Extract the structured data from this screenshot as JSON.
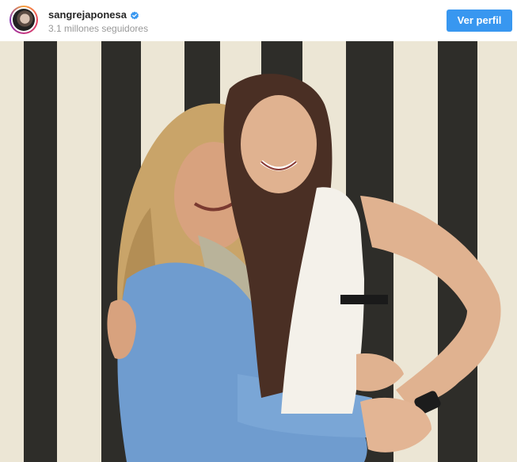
{
  "post": {
    "username": "sangrejaponesa",
    "followers": "3.1 millones seguidores",
    "view_profile_label": "Ver perfil",
    "verified": true,
    "photo_description": "photo of two smiling women hugging in front of a black and white vertical striped wall"
  },
  "icons": {
    "avatar": "profile-avatar",
    "verified": "verified-badge-icon"
  },
  "colors": {
    "accent": "#3897f0",
    "username": "#262626",
    "secondary_text": "#999999"
  }
}
